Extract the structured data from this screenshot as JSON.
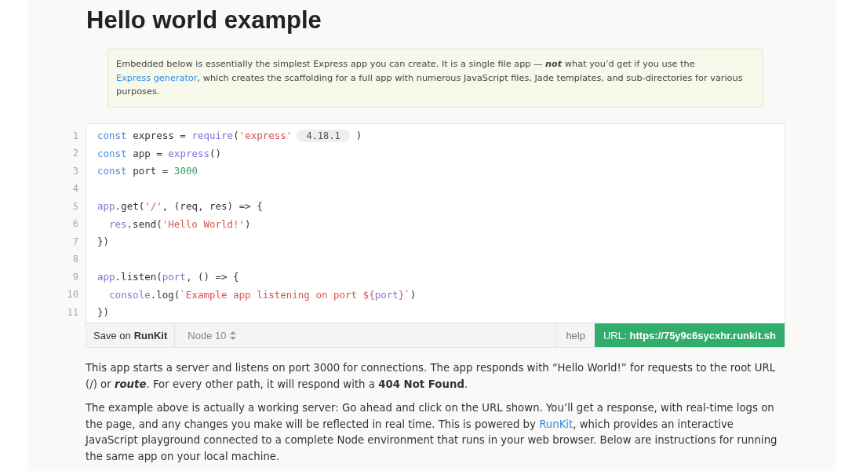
{
  "title": "Hello world example",
  "note": [
    {
      "kind": "plain",
      "text": "Embedded below is essentially the simplest Express app you can create. It is a single file app — "
    },
    {
      "kind": "bolditalic",
      "text": "not"
    },
    {
      "kind": "plain",
      "text": " what you’d get if you use the "
    },
    {
      "kind": "link",
      "text": "Express generator"
    },
    {
      "kind": "plain",
      "text": ", which creates the scaffolding for a full app with numerous JavaScript files, Jade templates, and sub-directories for various purposes."
    }
  ],
  "code": {
    "lines": [
      {
        "number": "1",
        "tokens": [
          {
            "kind": "keyword",
            "text": "const"
          },
          {
            "kind": "plain",
            "text": " express = "
          },
          {
            "kind": "call",
            "text": "require"
          },
          {
            "kind": "plain",
            "text": "("
          },
          {
            "kind": "string",
            "text": "'express'"
          },
          {
            "kind": "badge",
            "text": "4.18.1"
          },
          {
            "kind": "plain",
            "text": ")"
          }
        ]
      },
      {
        "number": "2",
        "tokens": [
          {
            "kind": "keyword",
            "text": "const"
          },
          {
            "kind": "plain",
            "text": " app = "
          },
          {
            "kind": "call",
            "text": "express"
          },
          {
            "kind": "plain",
            "text": "()"
          }
        ]
      },
      {
        "number": "3",
        "tokens": [
          {
            "kind": "keyword",
            "text": "const"
          },
          {
            "kind": "plain",
            "text": " port = "
          },
          {
            "kind": "number",
            "text": "3000"
          }
        ]
      },
      {
        "number": "4"
      },
      {
        "number": "5",
        "tokens": [
          {
            "kind": "call",
            "text": "app"
          },
          {
            "kind": "plain",
            "text": ".get("
          },
          {
            "kind": "string",
            "text": "'/'"
          },
          {
            "kind": "plain",
            "text": ", (req, res) => {"
          }
        ]
      },
      {
        "number": "6",
        "indented": true,
        "tokens": [
          {
            "kind": "call",
            "text": "res"
          },
          {
            "kind": "plain",
            "text": ".send("
          },
          {
            "kind": "string",
            "text": "'Hello World!'"
          },
          {
            "kind": "plain",
            "text": ")"
          }
        ]
      },
      {
        "number": "7",
        "tokens": [
          {
            "kind": "plain",
            "text": "})"
          }
        ]
      },
      {
        "number": "8"
      },
      {
        "number": "9",
        "tokens": [
          {
            "kind": "call",
            "text": "app"
          },
          {
            "kind": "plain",
            "text": ".listen("
          },
          {
            "kind": "call",
            "text": "port"
          },
          {
            "kind": "plain",
            "text": ", () => {"
          }
        ]
      },
      {
        "number": "10",
        "indented": true,
        "tokens": [
          {
            "kind": "call",
            "text": "console"
          },
          {
            "kind": "plain",
            "text": ".log("
          },
          {
            "kind": "string",
            "text": "`Example app listening on port ${"
          },
          {
            "kind": "call",
            "text": "port"
          },
          {
            "kind": "string",
            "text": "}`"
          },
          {
            "kind": "plain",
            "text": ")"
          }
        ]
      },
      {
        "number": "11",
        "tokens": [
          {
            "kind": "plain",
            "text": "})"
          }
        ]
      }
    ]
  },
  "toolbar": {
    "save_prefix": "Save on",
    "save_brand": "RunKit",
    "node_version": "Node 10",
    "help": "help",
    "url_label": "URL:",
    "url": "https://75y9c6sycxhr.runkit.sh"
  },
  "paragraphs": [
    [
      {
        "kind": "plain",
        "text": "This app starts a server and listens on port 3000 for connections. The app responds with “Hello World!” for requests to the root URL (/) or "
      },
      {
        "kind": "bolditalic",
        "text": "route"
      },
      {
        "kind": "plain",
        "text": ". For every other path, it will respond with a "
      },
      {
        "kind": "bold",
        "text": "404 Not Found"
      },
      {
        "kind": "plain",
        "text": "."
      }
    ],
    [
      {
        "kind": "plain",
        "text": "The example above is actually a working server: Go ahead and click on the URL shown. You’ll get a response, with real-time logs on the page, and any changes you make will be reflected in real time. This is powered by "
      },
      {
        "kind": "link",
        "text": "RunKit"
      },
      {
        "kind": "plain",
        "text": ", which provides an interactive JavaScript playground connected to a complete Node environment that runs in your web browser. Below are instructions for running the same app on your local machine."
      }
    ]
  ]
}
